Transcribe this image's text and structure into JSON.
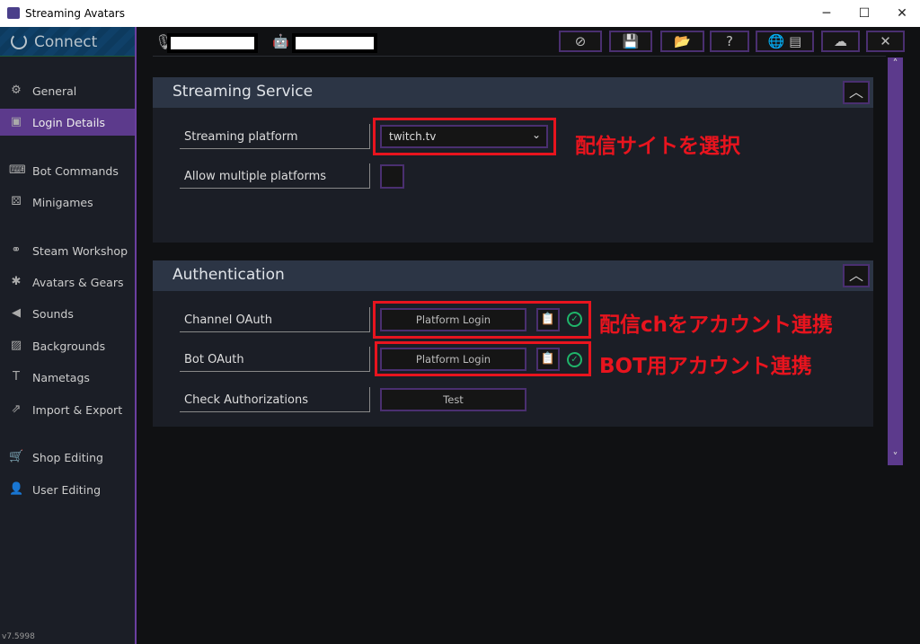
{
  "window": {
    "title": "Streaming Avatars",
    "minimize": "─",
    "maximize": "☐",
    "close": "✕"
  },
  "sidebar": {
    "connect": "Connect",
    "version": "v7.5998",
    "items": [
      {
        "label": "General",
        "icon": "gear-icon",
        "glyph": "⚙"
      },
      {
        "label": "Login Details",
        "icon": "contact-book-icon",
        "glyph": "▣"
      },
      {
        "label": "Bot Commands",
        "icon": "terminal-icon",
        "glyph": "⌨"
      },
      {
        "label": "Minigames",
        "icon": "dice-icon",
        "glyph": "⚄"
      },
      {
        "label": "Steam Workshop",
        "icon": "steam-icon",
        "glyph": "⚭"
      },
      {
        "label": "Avatars & Gears",
        "icon": "person-icon",
        "glyph": "✱"
      },
      {
        "label": "Sounds",
        "icon": "speaker-icon",
        "glyph": "◀"
      },
      {
        "label": "Backgrounds",
        "icon": "image-icon",
        "glyph": "▨"
      },
      {
        "label": "Nametags",
        "icon": "text-width-icon",
        "glyph": "T"
      },
      {
        "label": "Import & Export",
        "icon": "share-icon",
        "glyph": "⇗"
      },
      {
        "label": "Shop Editing",
        "icon": "cart-icon",
        "glyph": "🛒"
      },
      {
        "label": "User Editing",
        "icon": "users-icon",
        "glyph": "👤"
      }
    ]
  },
  "toolbar": {
    "buttons": [
      {
        "name": "alert",
        "glyph": "⊘"
      },
      {
        "name": "save",
        "glyph": "💾"
      },
      {
        "name": "open-folder",
        "glyph": "📂"
      },
      {
        "name": "help",
        "glyph": "?"
      },
      {
        "name": "language",
        "glyph": "🌐 ▤"
      },
      {
        "name": "cloud",
        "glyph": "☁"
      },
      {
        "name": "exit",
        "glyph": "✕"
      }
    ]
  },
  "streaming_service": {
    "title": "Streaming Service",
    "platform_label": "Streaming platform",
    "platform_value": "twitch.tv",
    "multi_label": "Allow multiple platforms",
    "multi_checked": false
  },
  "authentication": {
    "title": "Authentication",
    "channel_label": "Channel OAuth",
    "bot_label": "Bot OAuth",
    "check_label": "Check Authorizations",
    "login_button": "Platform Login",
    "test_button": "Test",
    "check_glyph": "✓"
  },
  "annotations": {
    "note1": "配信サイトを選択",
    "note2": "配信chをアカウント連携",
    "note3": "BOT用アカウント連携",
    "color": "#e8141e"
  },
  "scrollbar": {
    "up": "˄",
    "down": "˅"
  }
}
